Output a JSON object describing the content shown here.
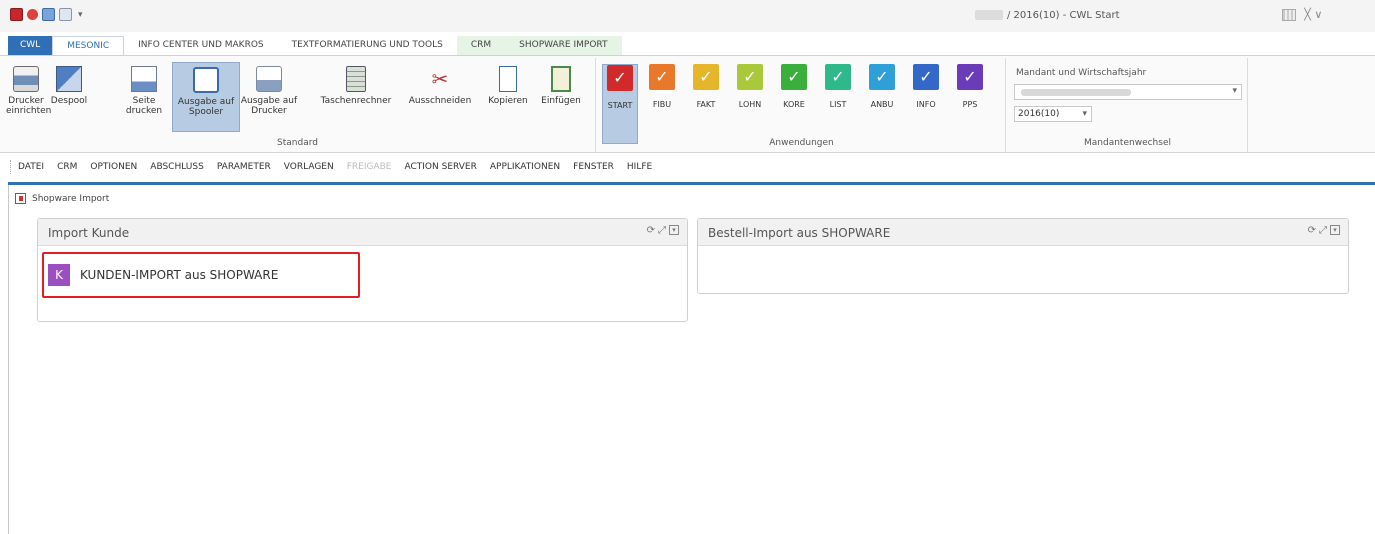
{
  "window": {
    "title_suffix": "/ 2016(10) - CWL Start",
    "controls_text": " ╳ ∨"
  },
  "tabs": [
    {
      "label": "CWL"
    },
    {
      "label": "MESONIC"
    },
    {
      "label": "INFO CENTER UND MAKROS"
    },
    {
      "label": "TEXTFORMATIERUNG UND TOOLS"
    },
    {
      "label": "CRM"
    },
    {
      "label": "SHOPWARE IMPORT"
    }
  ],
  "ribbon": {
    "standard": {
      "group_label": "Standard",
      "buttons": [
        {
          "label": "Drucker einrichten",
          "icon": "printer-icon"
        },
        {
          "label": "Despool",
          "icon": "despool-icon"
        },
        {
          "label": "Seite drucken",
          "icon": "print-page-icon"
        },
        {
          "label": "Ausgabe auf Spooler",
          "icon": "spooler-icon"
        },
        {
          "label": "Ausgabe auf Drucker",
          "icon": "print-output-icon"
        },
        {
          "label": "Taschenrechner",
          "icon": "calculator-icon"
        },
        {
          "label": "Ausschneiden",
          "icon": "scissors-icon"
        },
        {
          "label": "Kopieren",
          "icon": "copy-icon"
        },
        {
          "label": "Einfügen",
          "icon": "paste-icon"
        }
      ]
    },
    "anwendungen": {
      "group_label": "Anwendungen",
      "apps": [
        {
          "label": "START",
          "color": "#d22a2a",
          "glyph": "✓"
        },
        {
          "label": "FIBU",
          "color": "#e8782a",
          "glyph": "✓"
        },
        {
          "label": "FAKT",
          "color": "#e5b62a",
          "glyph": "✓"
        },
        {
          "label": "LOHN",
          "color": "#a9c83a",
          "glyph": "✓"
        },
        {
          "label": "KORE",
          "color": "#3cae3c",
          "glyph": "✓"
        },
        {
          "label": "LIST",
          "color": "#2fb98a",
          "glyph": "✓"
        },
        {
          "label": "ANBU",
          "color": "#2f9fd8",
          "glyph": "✓"
        },
        {
          "label": "INFO",
          "color": "#3468c8",
          "glyph": "✓"
        },
        {
          "label": "PPS",
          "color": "#6a3cb8",
          "glyph": "✓"
        }
      ]
    },
    "mandant": {
      "title": "Mandant und Wirtschaftsjahr",
      "year_value": "2016(10)",
      "group_label": "Mandantenwechsel"
    }
  },
  "menu": [
    {
      "label": "DATEI",
      "enabled": true
    },
    {
      "label": "CRM",
      "enabled": true
    },
    {
      "label": "OPTIONEN",
      "enabled": true
    },
    {
      "label": "ABSCHLUSS",
      "enabled": true
    },
    {
      "label": "PARAMETER",
      "enabled": true
    },
    {
      "label": "VORLAGEN",
      "enabled": true
    },
    {
      "label": "FREIGABE",
      "enabled": false
    },
    {
      "label": "ACTION SERVER",
      "enabled": true
    },
    {
      "label": "APPLIKATIONEN",
      "enabled": true
    },
    {
      "label": "FENSTER",
      "enabled": true
    },
    {
      "label": "HILFE",
      "enabled": true
    }
  ],
  "document": {
    "title": "Shopware Import",
    "panels": [
      {
        "title": "Import Kunde",
        "tile": {
          "badge": "K",
          "label": "KUNDEN-IMPORT aus SHOPWARE"
        }
      },
      {
        "title": "Bestell-Import aus SHOPWARE"
      }
    ]
  },
  "colors": {
    "accent": "#2f6fb5",
    "tile_highlight": "#e02020",
    "badge": "#9b4fc0"
  }
}
